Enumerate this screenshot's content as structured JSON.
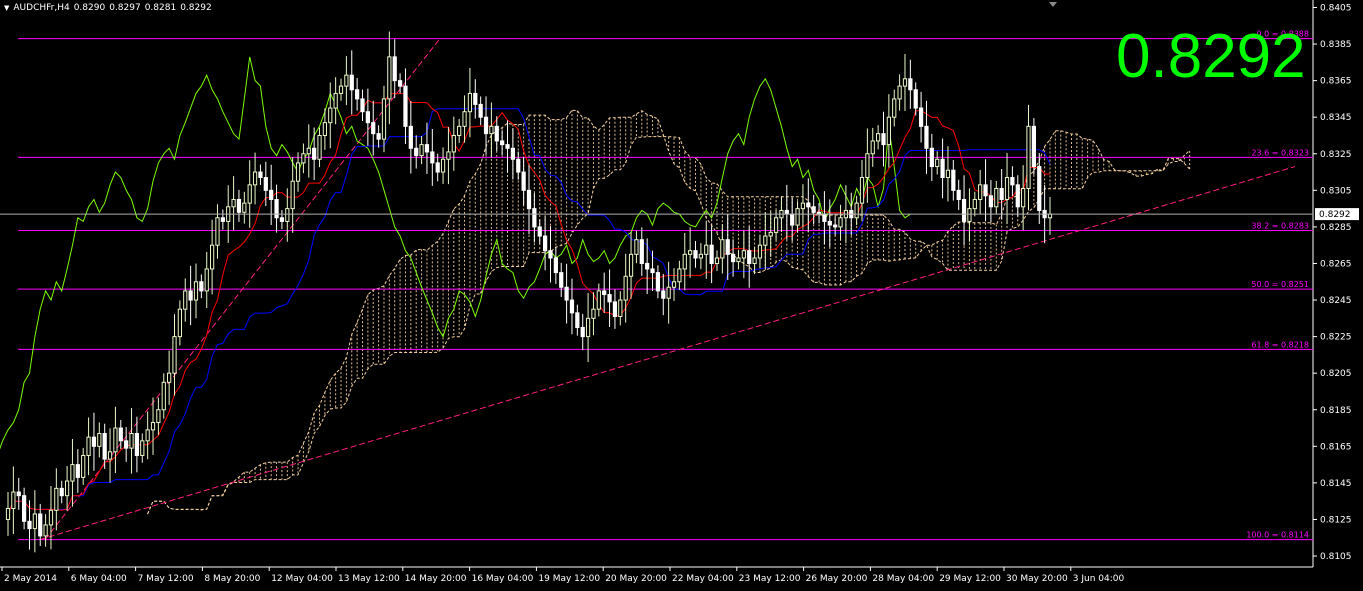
{
  "header": {
    "symbol": "AUDCHFr,H4",
    "open": "0.8290",
    "high": "0.8297",
    "low": "0.8281",
    "close": "0.8292"
  },
  "current_price_label": "0.8292",
  "big_price": "0.8292",
  "colors": {
    "background": "#000000",
    "bull": "#e8f8c8",
    "bear": "#ffffff",
    "tenkan": "#ff0000",
    "kijun": "#0000ff",
    "chikou": "#7cfc00",
    "fib": "#ff00ff",
    "trend": "#ff2080",
    "cloud": "#f5d0a0",
    "big_price": "#00ff00"
  },
  "chart_data": {
    "type": "candlestick",
    "title": "AUDCHFr,H4",
    "ylim": [
      0.8099,
      0.8408
    ],
    "y_ticks": [
      "0.8405",
      "0.8385",
      "0.8365",
      "0.8345",
      "0.8325",
      "0.8305",
      "0.8285",
      "0.8265",
      "0.8245",
      "0.8225",
      "0.8205",
      "0.8185",
      "0.8165",
      "0.8145",
      "0.8125",
      "0.8105"
    ],
    "x_ticks": [
      "2 May 2014",
      "6 May 04:00",
      "7 May 12:00",
      "8 May 20:00",
      "12 May 04:00",
      "13 May 12:00",
      "14 May 20:00",
      "16 May 04:00",
      "19 May 12:00",
      "20 May 20:00",
      "22 May 04:00",
      "23 May 12:00",
      "26 May 20:00",
      "28 May 04:00",
      "29 May 12:00",
      "30 May 20:00",
      "3 Jun 04:00"
    ],
    "fib_levels": [
      {
        "label": "0.0 = 0.8388",
        "value": 0.8388
      },
      {
        "label": "23.6 = 0.8323",
        "value": 0.8323
      },
      {
        "label": "38.2 = 0.8283",
        "value": 0.8283
      },
      {
        "label": "50.0 = 0.8251",
        "value": 0.8251
      },
      {
        "label": "61.8 = 0.8218",
        "value": 0.8218
      },
      {
        "label": "100.0 = 0.8114",
        "value": 0.8114
      }
    ],
    "current_price": 0.8292,
    "close_series": [
      0.8131,
      0.814,
      0.8138,
      0.8124,
      0.812,
      0.8128,
      0.8116,
      0.8122,
      0.813,
      0.8142,
      0.8138,
      0.8146,
      0.8155,
      0.8148,
      0.816,
      0.817,
      0.8165,
      0.8172,
      0.8158,
      0.8162,
      0.8175,
      0.8168,
      0.8164,
      0.8172,
      0.816,
      0.8168,
      0.8174,
      0.8178,
      0.8185,
      0.82,
      0.8205,
      0.8225,
      0.824,
      0.825,
      0.8245,
      0.8255,
      0.825,
      0.8262,
      0.8275,
      0.829,
      0.8288,
      0.8296,
      0.83,
      0.8293,
      0.8298,
      0.8308,
      0.8315,
      0.8312,
      0.8305,
      0.83,
      0.829,
      0.8288,
      0.8295,
      0.831,
      0.832,
      0.8325,
      0.8328,
      0.8322,
      0.8335,
      0.8342,
      0.835,
      0.8358,
      0.8362,
      0.8368,
      0.836,
      0.8355,
      0.8348,
      0.8342,
      0.8336,
      0.8333,
      0.8355,
      0.8378,
      0.8365,
      0.8362,
      0.834,
      0.8328,
      0.8324,
      0.833,
      0.8326,
      0.832,
      0.8315,
      0.8322,
      0.8326,
      0.8335,
      0.834,
      0.8348,
      0.8358,
      0.8352,
      0.8345,
      0.8336,
      0.834,
      0.8332,
      0.833,
      0.8328,
      0.8322,
      0.8315,
      0.8305,
      0.8295,
      0.8285,
      0.828,
      0.8272,
      0.8268,
      0.826,
      0.8252,
      0.8245,
      0.8238,
      0.823,
      0.8225,
      0.8235,
      0.824,
      0.825,
      0.8248,
      0.8244,
      0.8236,
      0.8245,
      0.8258,
      0.827,
      0.8278,
      0.8265,
      0.8262,
      0.826,
      0.825,
      0.8246,
      0.8252,
      0.8255,
      0.8262,
      0.827,
      0.8272,
      0.8268,
      0.827,
      0.8275,
      0.8265,
      0.8268,
      0.8278,
      0.827,
      0.8266,
      0.8268,
      0.8272,
      0.8265,
      0.8268,
      0.8275,
      0.828,
      0.8282,
      0.829,
      0.8294,
      0.8292,
      0.8286,
      0.8295,
      0.8298,
      0.8296,
      0.8293,
      0.8292,
      0.8288,
      0.8286,
      0.8285,
      0.829,
      0.8294,
      0.829,
      0.8298,
      0.8312,
      0.8325,
      0.8332,
      0.8336,
      0.833,
      0.8345,
      0.8355,
      0.8362,
      0.8366,
      0.836,
      0.835,
      0.834,
      0.8328,
      0.8318,
      0.8322,
      0.8312,
      0.8316,
      0.8305,
      0.83,
      0.8288,
      0.8295,
      0.83,
      0.8308,
      0.8302,
      0.8296,
      0.8306,
      0.83,
      0.8312,
      0.8308,
      0.8296,
      0.8306,
      0.834,
      0.8318,
      0.8294,
      0.829,
      0.8292
    ]
  }
}
